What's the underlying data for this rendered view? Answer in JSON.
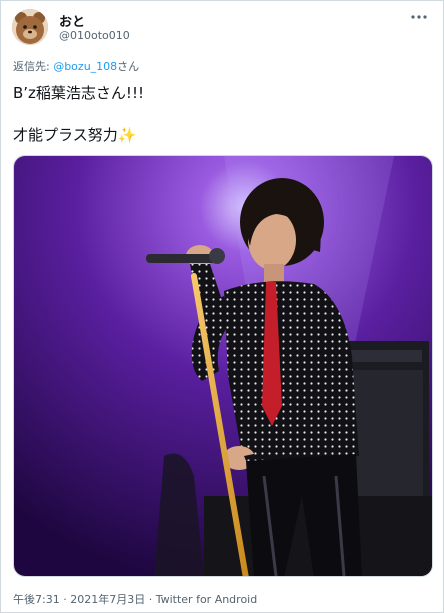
{
  "tweet": {
    "author": {
      "display_name": "おと",
      "handle": "@010oto010"
    },
    "more_icon": "more-dots-icon",
    "reply": {
      "prefix": "返信先: ",
      "mention": "@bozu_108",
      "suffix": "さん"
    },
    "text_line1": "B’z稲葉浩志さん!!!",
    "text_line2": "才能プラス努力",
    "text_emoji": "✨",
    "media": {
      "icon": "photo-singer-on-stage"
    },
    "meta": {
      "time": "午後7:31",
      "sep1": " · ",
      "date": "2021年7月3日",
      "sep2": " · ",
      "source": "Twitter for Android"
    }
  },
  "colors": {
    "accent": "#1d9bf0",
    "text": "#0f1419",
    "muted": "#536471",
    "border": "#cfd9de",
    "stage_purple": "#5a1fa0"
  }
}
